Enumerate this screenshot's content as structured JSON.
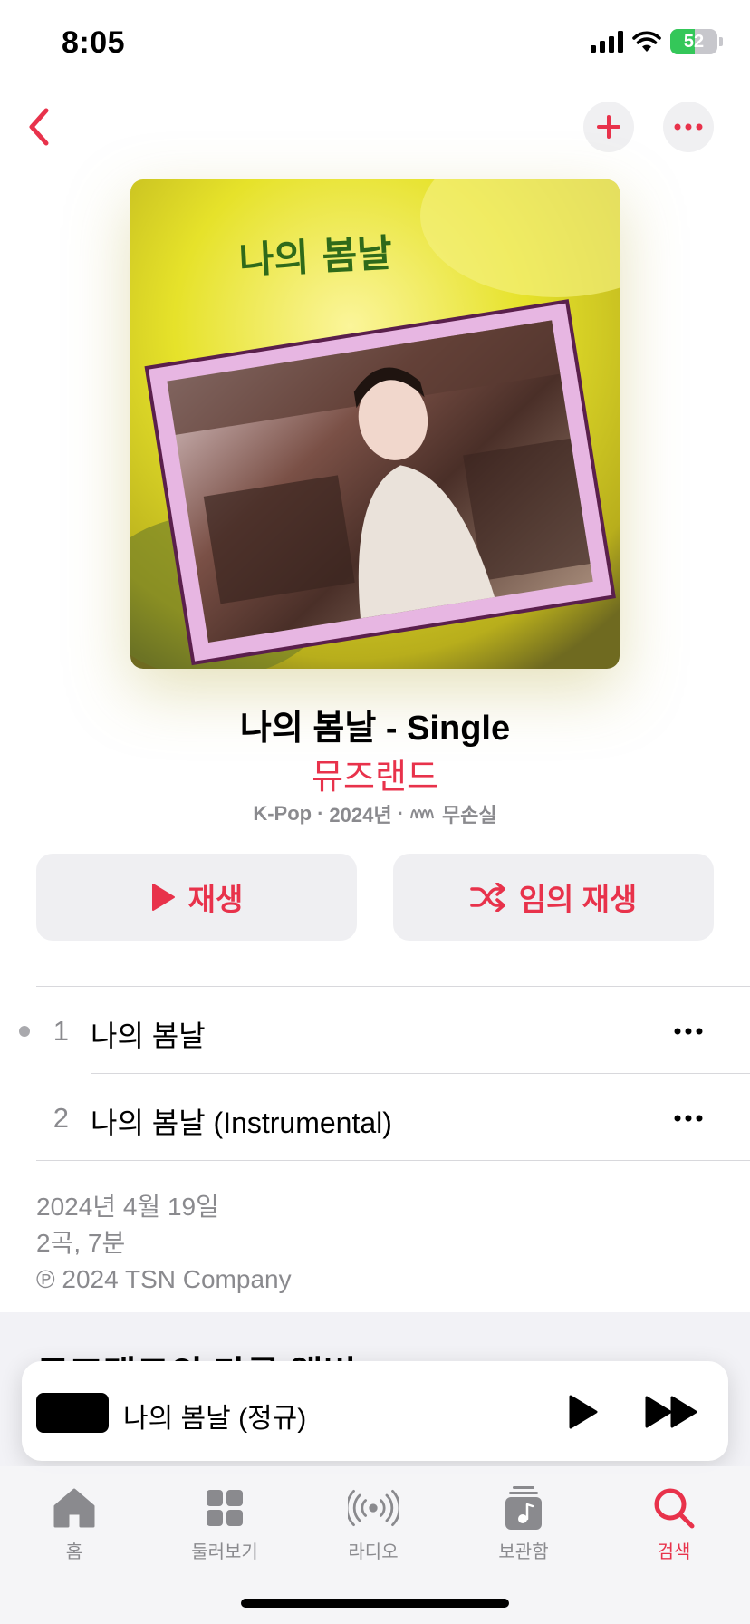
{
  "status": {
    "time": "8:05",
    "battery": "52",
    "battery_level": 0.52
  },
  "album": {
    "title": "나의 봄날 - Single",
    "artist": "뮤즈랜드",
    "genre": "K-Pop",
    "separator": "·",
    "year": "2024년",
    "quality": "무손실",
    "cover_text": "나의 봄날"
  },
  "actions": {
    "play": "재생",
    "shuffle": "임의 재생"
  },
  "tracks": [
    {
      "number": "1",
      "title": "나의 봄날"
    },
    {
      "number": "2",
      "title": "나의 봄날 (Instrumental)"
    }
  ],
  "release": {
    "date": "2024년 4월 19일",
    "summary": "2곡, 7분",
    "copyright": "℗ 2024 TSN Company"
  },
  "more_section": {
    "title": "뮤즈랜드의 다른 앨범"
  },
  "mini_player": {
    "title": "나의 봄날 (정규)"
  },
  "tabs": [
    {
      "label": "홈",
      "icon": "house-icon"
    },
    {
      "label": "둘러보기",
      "icon": "grid-icon"
    },
    {
      "label": "라디오",
      "icon": "radio-waves-icon"
    },
    {
      "label": "보관함",
      "icon": "library-icon"
    },
    {
      "label": "검색",
      "icon": "search-icon",
      "active": true
    }
  ],
  "colors": {
    "accent": "#e8324b",
    "secondary_text": "#8a8a8e",
    "button_bg": "#efeff2"
  }
}
